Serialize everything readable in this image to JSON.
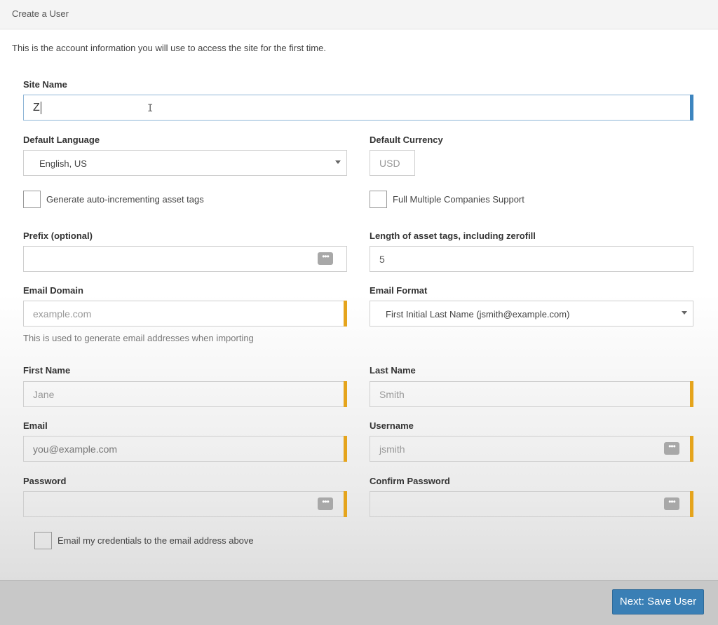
{
  "header": {
    "title": "Create a User"
  },
  "intro": "This is the account information you will use to access the site for the first time.",
  "site_name": {
    "label": "Site Name",
    "value": "Z"
  },
  "default_language": {
    "label": "Default Language",
    "value": "English, US"
  },
  "default_currency": {
    "label": "Default Currency",
    "placeholder": "USD"
  },
  "auto_asset_tags": {
    "label": "Generate auto-incrementing asset tags"
  },
  "multiple_companies": {
    "label": "Full Multiple Companies Support"
  },
  "prefix": {
    "label": "Prefix (optional)",
    "value": ""
  },
  "asset_tag_length": {
    "label": "Length of asset tags, including zerofill",
    "value": "5"
  },
  "email_domain": {
    "label": "Email Domain",
    "placeholder": "example.com",
    "help": "This is used to generate email addresses when importing"
  },
  "email_format": {
    "label": "Email Format",
    "value": "First Initial Last Name (jsmith@example.com)"
  },
  "first_name": {
    "label": "First Name",
    "placeholder": "Jane"
  },
  "last_name": {
    "label": "Last Name",
    "placeholder": "Smith"
  },
  "email": {
    "label": "Email",
    "placeholder": "you@example.com"
  },
  "username": {
    "label": "Username",
    "placeholder": "jsmith"
  },
  "password": {
    "label": "Password",
    "value": ""
  },
  "confirm_password": {
    "label": "Confirm Password",
    "value": ""
  },
  "email_credentials": {
    "label": "Email my credentials to the email address above"
  },
  "footer": {
    "submit_label": "Next: Save User"
  },
  "icons": {
    "password_manager": "dots-icon",
    "select": "chevron-down-icon"
  },
  "colors": {
    "required": "#e5a41c",
    "focus": "#3d85bf",
    "primary": "#3a7fb5"
  }
}
